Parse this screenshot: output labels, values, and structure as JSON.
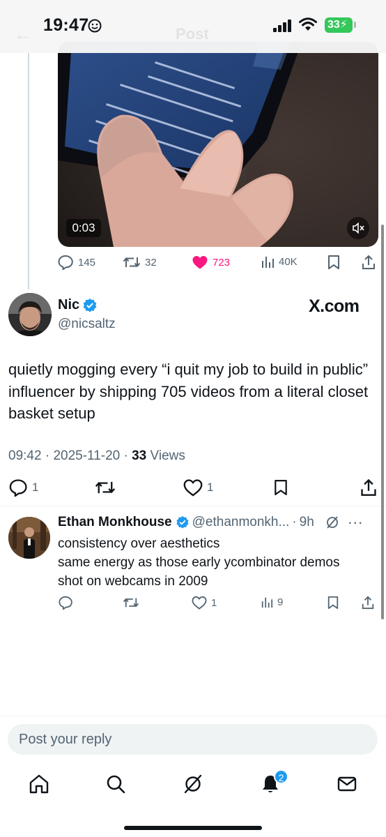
{
  "status": {
    "time": "19:47",
    "battery": "33"
  },
  "header": {
    "back_icon": "back-arrow-icon",
    "title": "Post"
  },
  "video": {
    "duration": "0:03",
    "mute_icon": "speaker-muted-icon"
  },
  "parent_actions": {
    "replies": "145",
    "reposts": "32",
    "likes": "723",
    "views": "40K"
  },
  "tweet": {
    "name": "Nic",
    "handle": "@nicsaltz",
    "brand": "X.com",
    "text": "quietly mogging every “i quit my job to build in public” influencer by shipping 705 videos from a literal closet basket setup",
    "time": "09:42",
    "date": "2025-11-20",
    "views_count": "33",
    "views_label": "Views",
    "replies": "1",
    "likes": "1"
  },
  "reply": {
    "name": "Ethan Monkhouse",
    "handle": "@ethanmonkh...",
    "time": "9h",
    "lines": [
      "consistency over aesthetics",
      "same energy as those early ycombinator demos",
      "shot on webcams in 2009"
    ],
    "likes": "1",
    "views": "9"
  },
  "composer": {
    "placeholder": "Post your reply"
  },
  "tabbar": {
    "notifications_badge": "2"
  },
  "colors": {
    "like_active": "#f91880",
    "verified": "#1d9bf0",
    "battery": "#34c759"
  }
}
